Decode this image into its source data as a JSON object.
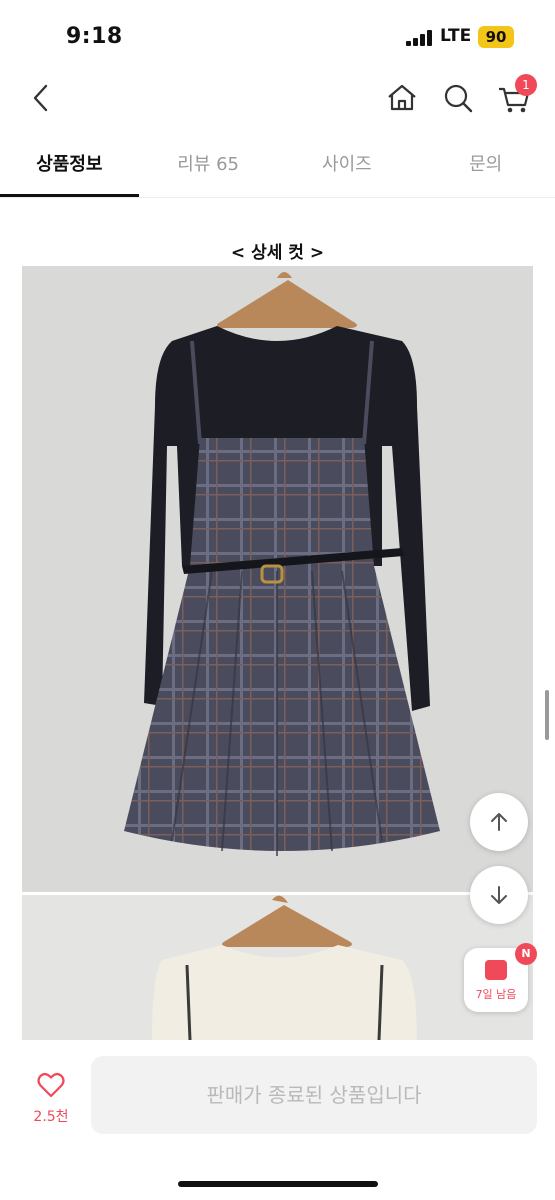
{
  "status_bar": {
    "time": "9:18",
    "network": "LTE",
    "battery": "90"
  },
  "nav": {
    "cart_count": "1"
  },
  "tabs": [
    {
      "label": "상품정보",
      "active": true
    },
    {
      "label": "리뷰 65",
      "active": false
    },
    {
      "label": "사이즈",
      "active": false
    },
    {
      "label": "문의",
      "active": false
    }
  ],
  "content": {
    "section_title": "< 상세 컷 >"
  },
  "floating": {
    "coupon_label": "7일 남음",
    "coupon_badge": "N"
  },
  "bottom_bar": {
    "like_count": "2.5천",
    "sold_out_label": "판매가 종료된 상품입니다"
  },
  "colors": {
    "accent": "#f04a5a",
    "battery": "#f3c516",
    "disabled_bg": "#f2f2f2",
    "disabled_text": "#b9b9b9"
  },
  "icons": [
    "back-icon",
    "home-icon",
    "search-icon",
    "cart-icon",
    "arrow-up-icon",
    "arrow-down-icon",
    "coupon-icon",
    "heart-icon"
  ]
}
